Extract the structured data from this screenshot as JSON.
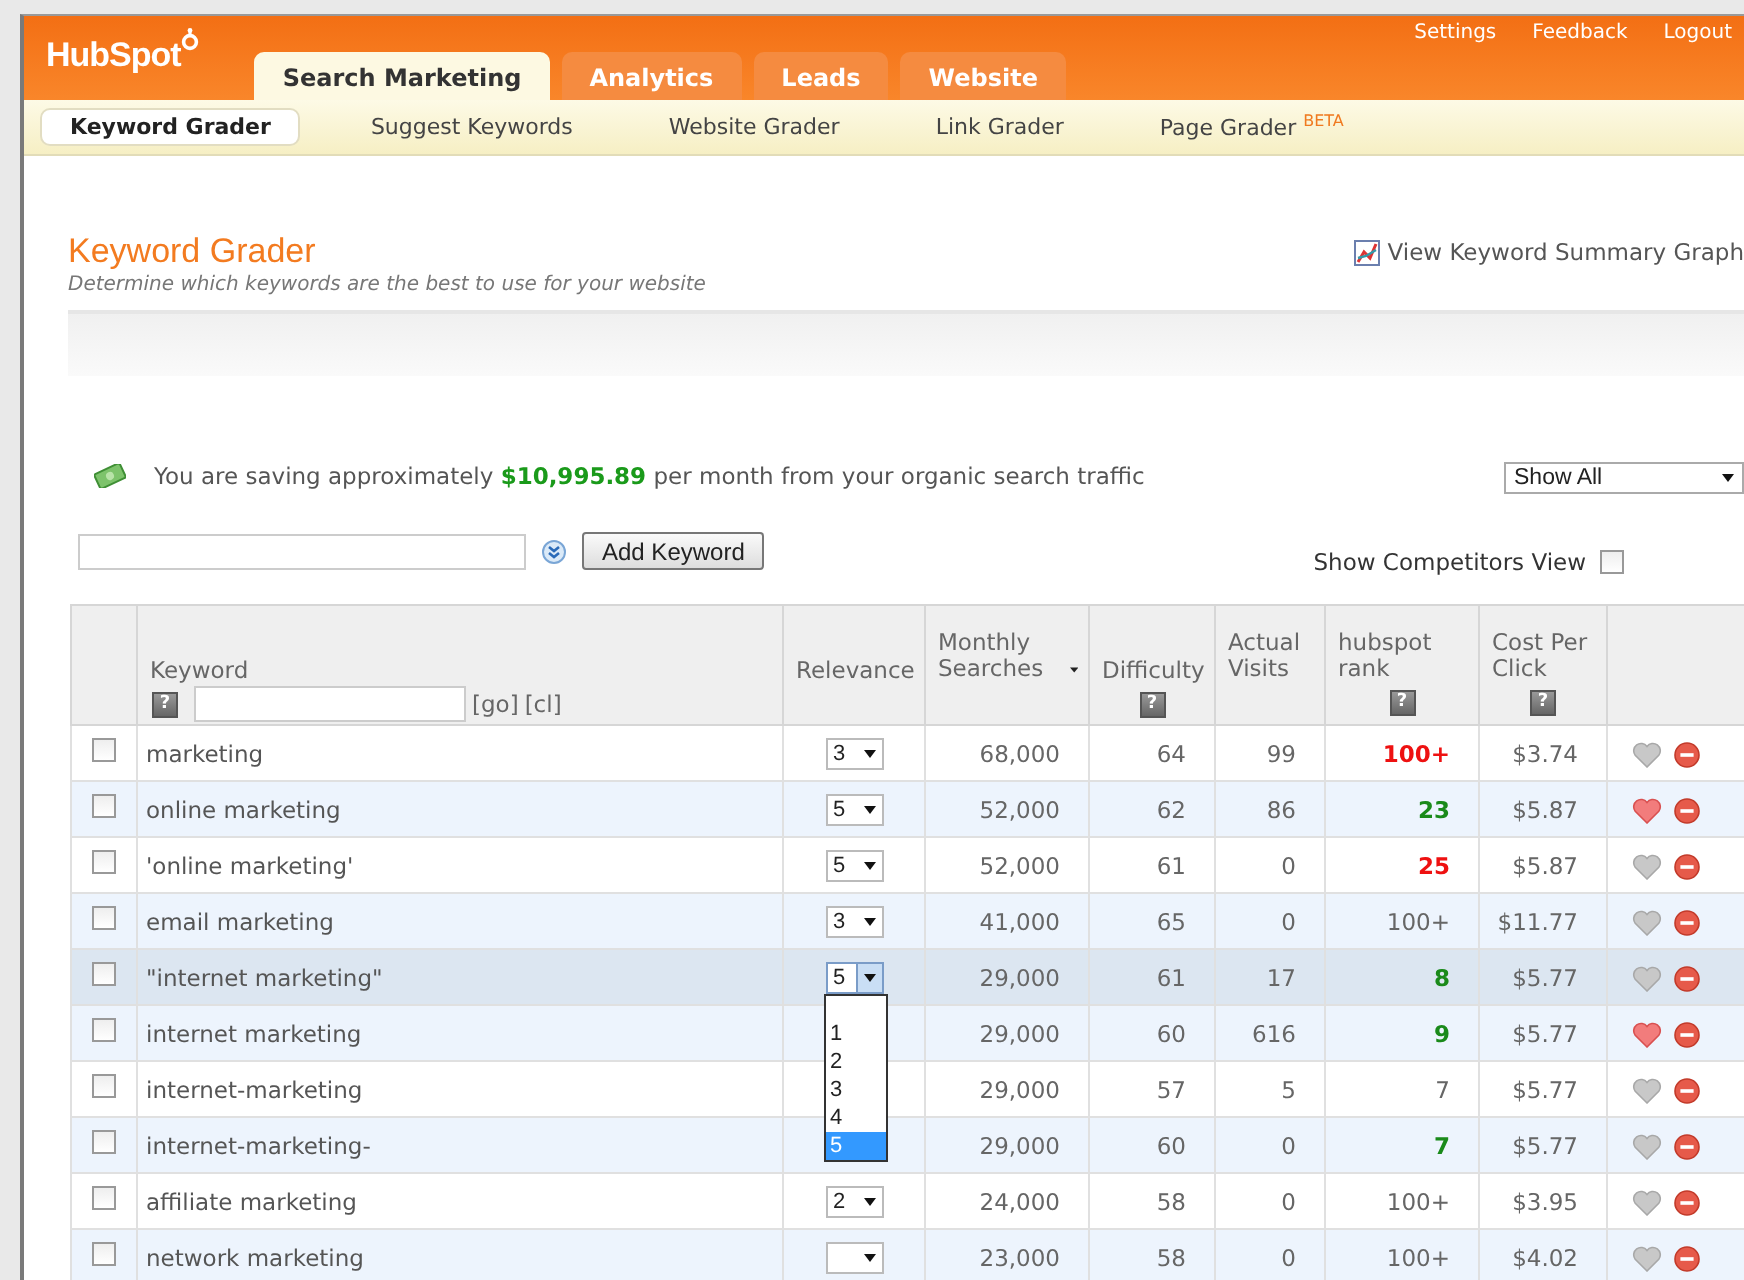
{
  "header": {
    "logo": "HubSpot",
    "tabs": [
      {
        "label": "Search Marketing",
        "selected": true
      },
      {
        "label": "Analytics",
        "selected": false
      },
      {
        "label": "Leads",
        "selected": false
      },
      {
        "label": "Website",
        "selected": false
      }
    ],
    "links": [
      "Settings",
      "Feedback",
      "Logout"
    ]
  },
  "subnav": [
    {
      "label": "Keyword Grader",
      "selected": true
    },
    {
      "label": "Suggest Keywords",
      "selected": false
    },
    {
      "label": "Website Grader",
      "selected": false
    },
    {
      "label": "Link Grader",
      "selected": false
    },
    {
      "label": "Page Grader $^{BETA}$",
      "selected": false
    }
  ],
  "page": {
    "title": "Keyword Grader",
    "subtitle": "Determine which keywords are the best to use for your website",
    "graph_link": "View Keyword Summary Graph"
  },
  "savings": "You are saving approximately **$10,995.89** per month from your organic search traffic",
  "filter": {
    "value": "Show All"
  },
  "add_button": "Add Keyword",
  "competitors": {
    "label": "Show Competitors View",
    "checked": false
  },
  "table": {
    "columns": [
      {
        "label": "Keyword",
        "help": "?",
        "filter_links": [
          "[go]",
          "[cl]"
        ]
      },
      {
        "label": "Relevance"
      },
      {
        "label": "Monthly Searches",
        "sorted": true
      },
      {
        "label": "Difficulty",
        "help": "?"
      },
      {
        "label": "Actual Visits"
      },
      {
        "label": "hubspot rank",
        "help": "?"
      },
      {
        "label": "Cost Per Click",
        "help": "?"
      }
    ],
    "rows": [
      {
        "checked": false,
        "highlighted": false,
        "keyword": "marketing",
        "relevance": {
          "kind": "select",
          "value": "3"
        },
        "searches": "68,000",
        "difficulty": "64",
        "visits": "99",
        "rank": "100+",
        "color": "#ee1111",
        "rank_bold": true,
        "cpc": "$3.74",
        "favorite": false
      },
      {
        "checked": false,
        "highlighted": false,
        "keyword": "online marketing",
        "relevance": {
          "kind": "select",
          "value": "5"
        },
        "searches": "52,000",
        "difficulty": "62",
        "visits": "86",
        "rank": "23",
        "color": "#1a8a1a",
        "rank_bold": true,
        "cpc": "$5.87",
        "favorite": true
      },
      {
        "checked": false,
        "highlighted": false,
        "keyword": "'online marketing'",
        "relevance": {
          "kind": "select",
          "value": "5"
        },
        "searches": "52,000",
        "difficulty": "61",
        "visits": "0",
        "rank": "25",
        "color": "#ee1111",
        "rank_bold": true,
        "cpc": "$5.87",
        "favorite": false
      },
      {
        "checked": false,
        "highlighted": false,
        "keyword": "email marketing",
        "relevance": {
          "kind": "select",
          "value": "3"
        },
        "searches": "41,000",
        "difficulty": "65",
        "visits": "0",
        "rank": "100+",
        "color": "#666666",
        "rank_bold": false,
        "cpc": "$11.77",
        "favorite": false
      },
      {
        "checked": false,
        "highlighted": true,
        "keyword": "\"internet marketing\"",
        "relevance": {
          "kind": "open",
          "value": "5",
          "options": [
            {
              "label": "1",
              "selected": false
            },
            {
              "label": "2",
              "selected": false
            },
            {
              "label": "3",
              "selected": false
            },
            {
              "label": "4",
              "selected": false
            },
            {
              "label": "5",
              "selected": true
            }
          ]
        },
        "searches": "29,000",
        "difficulty": "61",
        "visits": "17",
        "rank": "8",
        "color": "#1a8a1a",
        "rank_bold": true,
        "cpc": "$5.77",
        "favorite": false
      },
      {
        "checked": false,
        "highlighted": false,
        "keyword": "internet marketing",
        "searches": "29,000",
        "difficulty": "60",
        "visits": "616",
        "rank": "9",
        "color": "#1a8a1a",
        "rank_bold": true,
        "cpc": "$5.77",
        "favorite": true
      },
      {
        "checked": false,
        "highlighted": false,
        "keyword": "internet-marketing",
        "searches": "29,000",
        "difficulty": "57",
        "visits": "5",
        "rank": "7",
        "color": "#666666",
        "rank_bold": false,
        "cpc": "$5.77",
        "favorite": false
      },
      {
        "checked": false,
        "highlighted": false,
        "keyword": "internet-marketing-",
        "searches": "29,000",
        "difficulty": "60",
        "visits": "0",
        "rank": "7",
        "color": "#1a8a1a",
        "rank_bold": true,
        "cpc": "$5.77",
        "favorite": false
      },
      {
        "checked": false,
        "highlighted": false,
        "keyword": "affiliate marketing",
        "relevance": {
          "kind": "select",
          "value": "2"
        },
        "searches": "24,000",
        "difficulty": "58",
        "visits": "0",
        "rank": "100+",
        "color": "#666666",
        "rank_bold": false,
        "cpc": "$3.95",
        "favorite": false
      },
      {
        "checked": false,
        "highlighted": false,
        "keyword": "network marketing",
        "relevance": {
          "kind": "select"
        },
        "searches": "23,000",
        "difficulty": "58",
        "visits": "0",
        "rank": "100+",
        "color": "#666666",
        "rank_bold": false,
        "cpc": "$4.02",
        "favorite": false
      }
    ]
  }
}
